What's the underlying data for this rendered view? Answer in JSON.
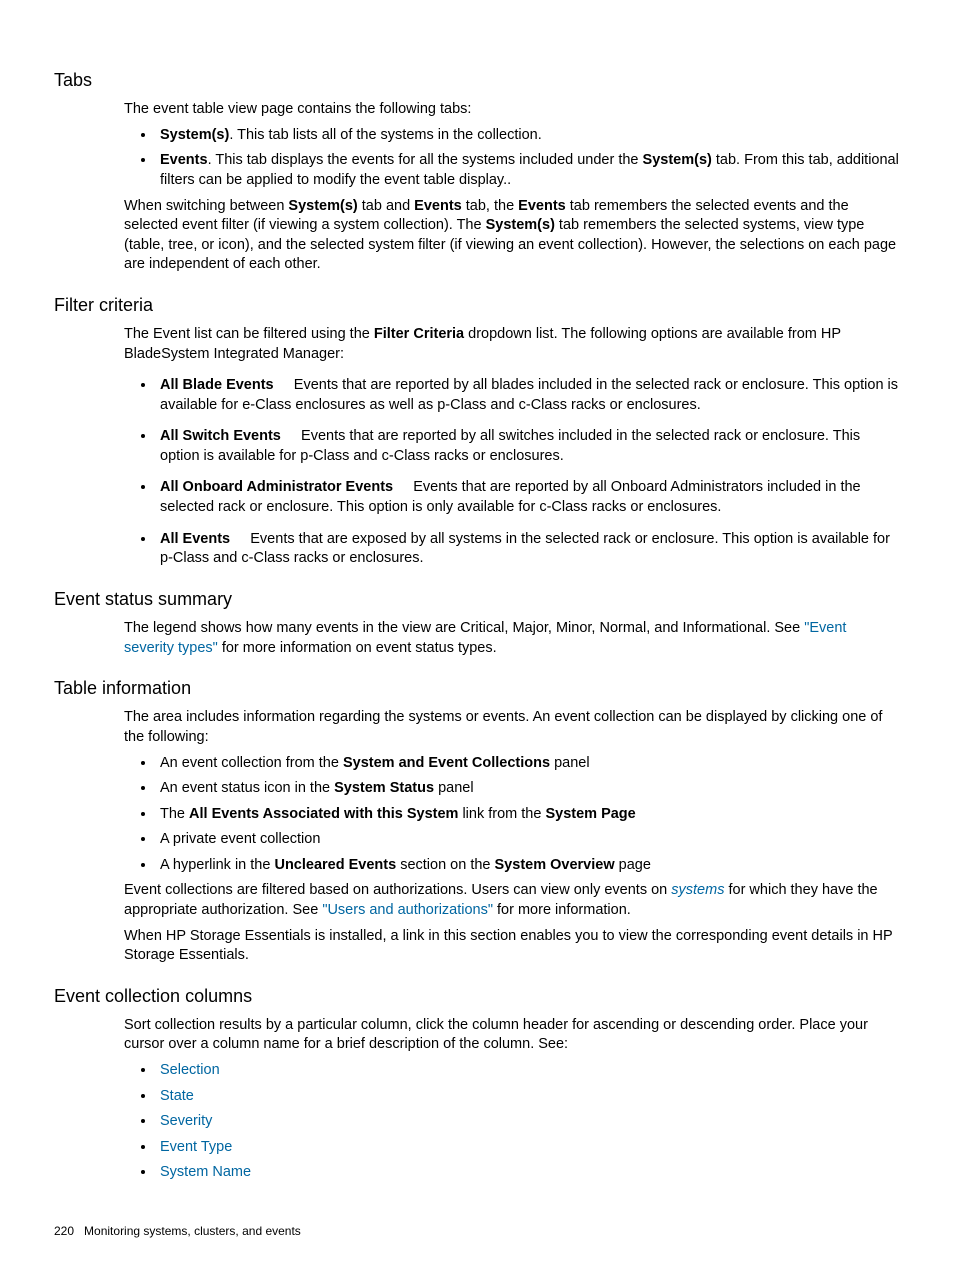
{
  "sections": {
    "tabs": {
      "heading": "Tabs",
      "intro": "The event table view page contains the following tabs:",
      "item1_bold": "System(s)",
      "item1_rest": ". This tab lists all of the systems in the collection.",
      "item2_bold": "Events",
      "item2_mid": ". This tab displays the events for all the systems included under the ",
      "item2_bold2": "System(s)",
      "item2_rest": " tab. From this tab, additional filters can be applied to modify the event table display..",
      "p2_a": "When switching between ",
      "p2_b": "System(s)",
      "p2_c": " tab and ",
      "p2_d": "Events",
      "p2_e": " tab, the ",
      "p2_f": "Events",
      "p2_g": " tab remembers the selected events and the selected event filter (if viewing a system collection). The ",
      "p2_h": "System(s)",
      "p2_i": " tab remembers the selected systems, view type (table, tree, or icon), and the selected system filter (if viewing an event collection). However, the selections on each page are independent of each other."
    },
    "filter": {
      "heading": "Filter criteria",
      "p1_a": "The Event list can be filtered using the ",
      "p1_b": "Filter Criteria",
      "p1_c": " dropdown list. The following options are available from HP BladeSystem Integrated Manager:",
      "i1_b": "All Blade Events",
      "i1_r": "Events that are reported by all blades included in the selected rack or enclosure. This option is available for e-Class enclosures as well as p-Class and c-Class racks or enclosures.",
      "i2_b": "All Switch Events",
      "i2_r": "Events that are reported by all switches included in the selected rack or enclosure. This option is available for p-Class and c-Class racks or enclosures.",
      "i3_b": "All Onboard Administrator Events",
      "i3_r": "Events that are reported by all Onboard Administrators included in the selected rack or enclosure. This option is only available for c-Class racks or enclosures.",
      "i4_b": "All Events",
      "i4_r": "Events that are exposed by all systems in the selected rack or enclosure. This option is available for p-Class and c-Class racks or enclosures."
    },
    "ess": {
      "heading": "Event status summary",
      "p1_a": "The legend shows how many events in the view are Critical, Major, Minor, Normal, and Informational. See ",
      "p1_link": "\"Event severity types\"",
      "p1_c": " for more information on event status types."
    },
    "tinfo": {
      "heading": "Table information",
      "p1": "The area includes information regarding the systems or events. An event collection can be displayed by clicking one of the following:",
      "i1_a": "An event collection from the ",
      "i1_b": "System and Event Collections",
      "i1_c": " panel",
      "i2_a": "An event status icon in the ",
      "i2_b": "System Status",
      "i2_c": " panel",
      "i3_a": "The ",
      "i3_b": "All Events Associated with this System",
      "i3_c": " link from the ",
      "i3_d": "System Page",
      "i4": "A private event collection",
      "i5_a": "A hyperlink in the ",
      "i5_b": "Uncleared Events",
      "i5_c": " section on the ",
      "i5_d": "System Overview",
      "i5_e": " page",
      "p2_a": "Event collections are filtered based on authorizations. Users can view only events on ",
      "p2_link1": "systems",
      "p2_b": " for which they have the appropriate authorization. See ",
      "p2_link2": "\"Users and authorizations\"",
      "p2_c": " for more information.",
      "p3": "When HP Storage Essentials is installed, a link in this section enables you to view the corresponding event details in HP Storage Essentials."
    },
    "ecc": {
      "heading": "Event collection columns",
      "p1": "Sort collection results by a particular column, click the column header for ascending or descending order. Place your cursor over a column name for a brief description of the column. See:",
      "links": {
        "l1": "Selection",
        "l2": "State",
        "l3": "Severity",
        "l4": "Event Type",
        "l5": "System Name"
      }
    }
  },
  "footer": {
    "page": "220",
    "title": "Monitoring systems, clusters, and events"
  }
}
